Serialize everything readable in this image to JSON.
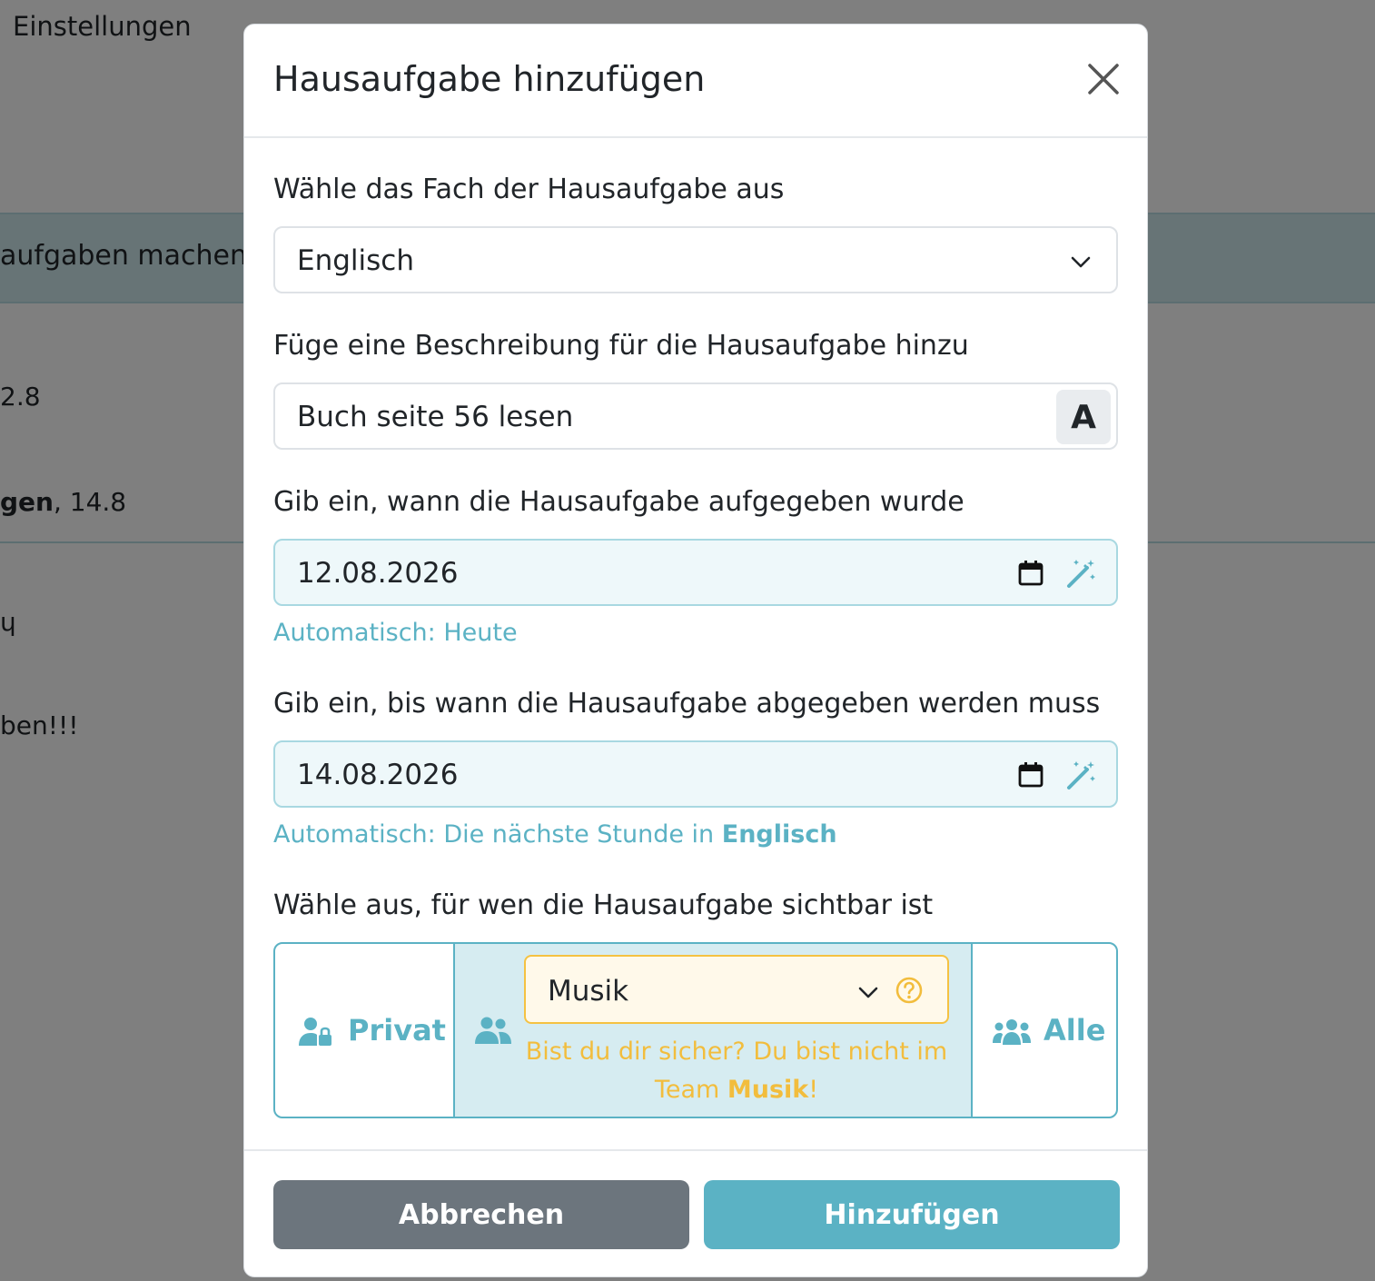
{
  "background": {
    "title": "Einstellungen",
    "band_text": "aufgaben machen",
    "row1_text": "2.8",
    "row2_bold": "gen",
    "row2_text": ", 14.8",
    "row3_text": "ben!!!"
  },
  "modal": {
    "title": "Hausaufgabe hinzufügen",
    "subject": {
      "label": "Wähle das Fach der Hausaufgabe aus",
      "value": "Englisch"
    },
    "description": {
      "label": "Füge eine Beschreibung für die Hausaufgabe hinzu",
      "value": "Buch seite 56 lesen",
      "format_button": "A"
    },
    "assigned": {
      "label": "Gib ein, wann die Hausaufgabe aufgegeben wurde",
      "value": "12.08.2026",
      "hint": "Automatisch: Heute"
    },
    "due": {
      "label": "Gib ein, bis wann die Hausaufgabe abgegeben werden muss",
      "value": "14.08.2026",
      "hint_prefix": "Automatisch: Die nächste Stunde in ",
      "hint_subject": "Englisch"
    },
    "visibility": {
      "label": "Wähle aus, für wen die Hausaufgabe sichtbar ist",
      "private_label": "Privat",
      "team_value": "Musik",
      "warning_prefix": "Bist du dir sicher? Du bist nicht im Team ",
      "warning_team": "Musik",
      "warning_suffix": "!",
      "all_label": "Alle"
    },
    "buttons": {
      "cancel": "Abbrechen",
      "add": "Hinzufügen"
    }
  },
  "colors": {
    "accent": "#5bb2c4",
    "warning": "#f2bd3d",
    "secondary": "#6c757d"
  }
}
